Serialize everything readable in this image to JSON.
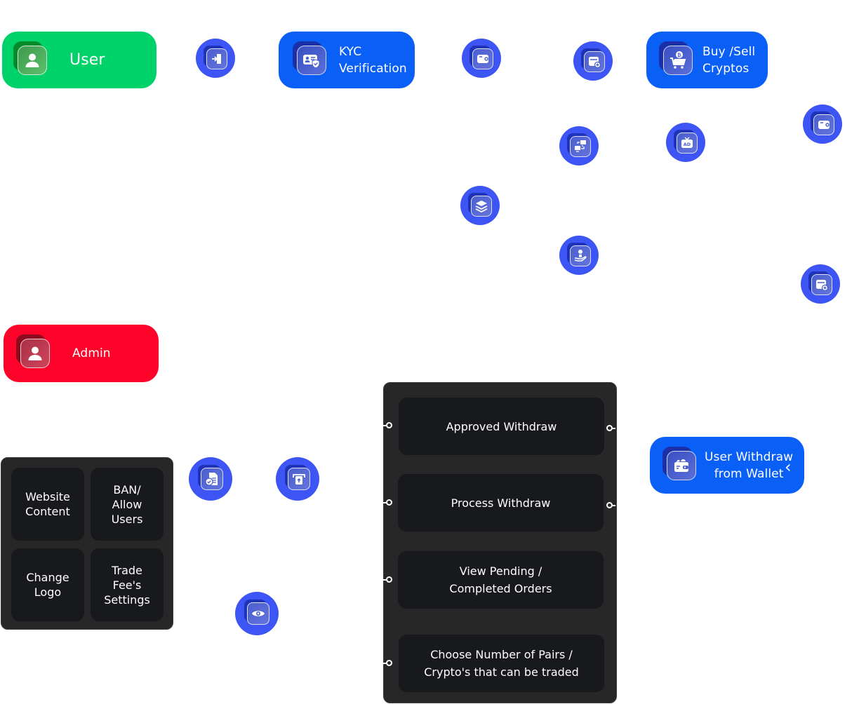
{
  "colors": {
    "user_green": "#00d26a",
    "primary_blue": "#0a5ff7",
    "admin_red": "#fe0329",
    "icon_circle_blue": "#3d55f5",
    "panel_dark": "#272727",
    "cell_dark": "#18191d"
  },
  "user_flow": {
    "role": {
      "label": "User",
      "icon": "user-icon"
    },
    "nodes": [
      {
        "label": "KYC\nVerification",
        "icon": "id-card-shield-icon"
      },
      {
        "label": "Buy /Sell\nCryptos",
        "icon": "cart-bitcoin-icon"
      }
    ],
    "icons": [
      {
        "name": "login-door-icon"
      },
      {
        "name": "wallet-icon"
      },
      {
        "name": "card-add-icon"
      },
      {
        "name": "network-transfer-icon"
      },
      {
        "name": "ad-tv-icon"
      },
      {
        "name": "wallet-icon"
      },
      {
        "name": "layers-icon"
      },
      {
        "name": "hand-coin-icon"
      },
      {
        "name": "card-add-icon"
      }
    ]
  },
  "admin_flow": {
    "role": {
      "label": "Admin",
      "icon": "user-icon"
    },
    "settings_grid": [
      {
        "label": "Website\nContent"
      },
      {
        "label": "BAN/\nAllow\nUsers"
      },
      {
        "label": "Change\nLogo"
      },
      {
        "label": "Trade\nFee's\nSettings"
      }
    ],
    "icons": [
      {
        "name": "document-check-icon"
      },
      {
        "name": "atm-withdraw-icon"
      },
      {
        "name": "eye-icon"
      }
    ],
    "actions": [
      {
        "label": "Approved Withdraw"
      },
      {
        "label": "Process Withdraw"
      },
      {
        "label": "View Pending /\nCompleted Orders"
      },
      {
        "label": "Choose Number of Pairs /\nCrypto's that can be traded"
      }
    ],
    "withdraw_node": {
      "label": "User  Withdraw\nfrom Wallet",
      "icon": "wallet-cash-icon",
      "chevron": "‹"
    }
  }
}
